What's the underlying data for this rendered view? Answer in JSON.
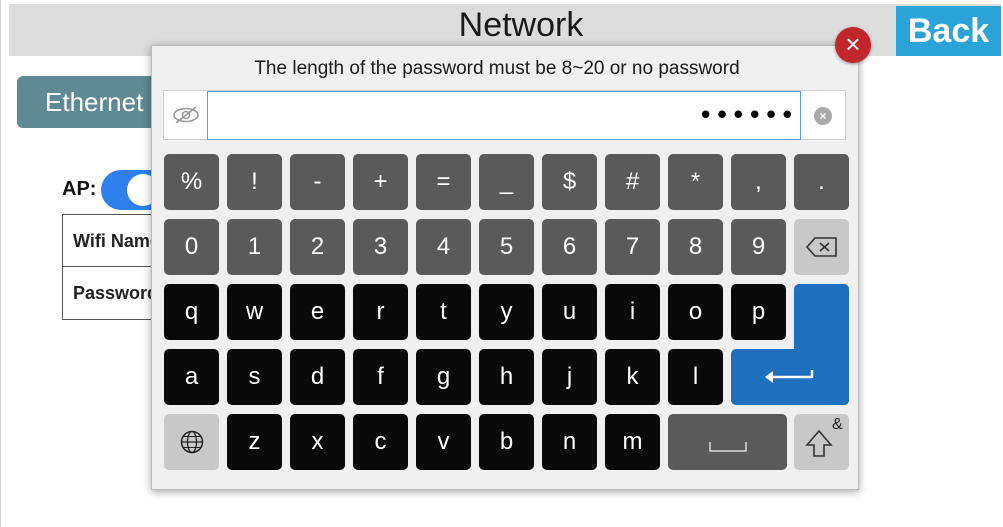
{
  "header": {
    "title": "Network",
    "back_label": "Back"
  },
  "tabs": {
    "ethernet_label": "Ethernet"
  },
  "ap": {
    "label": "AP:",
    "enabled": true
  },
  "form": {
    "rows": [
      "Wifi Name",
      "Password"
    ]
  },
  "dialog": {
    "hint": "The length of the password must be 8~20 or no password",
    "password_value": "••••••",
    "close_symbol": "×",
    "clear_symbol": "×"
  },
  "keyboard": {
    "symbols_row": [
      "%",
      "!",
      "-",
      "+",
      "=",
      "_",
      "$",
      "#",
      "*",
      ",",
      "."
    ],
    "numbers_row": [
      "0",
      "1",
      "2",
      "3",
      "4",
      "5",
      "6",
      "7",
      "8",
      "9"
    ],
    "row_q": [
      "q",
      "w",
      "e",
      "r",
      "t",
      "y",
      "u",
      "i",
      "o",
      "p"
    ],
    "row_a": [
      "a",
      "s",
      "d",
      "f",
      "g",
      "h",
      "j",
      "k",
      "l"
    ],
    "row_z": [
      "z",
      "x",
      "c",
      "v",
      "b",
      "n",
      "m"
    ],
    "shift_sup": "&",
    "icons": {
      "backspace": "backspace-icon",
      "enter": "enter-icon",
      "globe": "globe-icon",
      "space": "space-icon",
      "shift": "shift-icon"
    }
  },
  "colors": {
    "accent_blue": "#2ba3d8",
    "enter_blue": "#1f6fbf",
    "tab_teal": "#5f8a93",
    "close_red": "#c0262c",
    "toggle_blue": "#2f80ed"
  }
}
